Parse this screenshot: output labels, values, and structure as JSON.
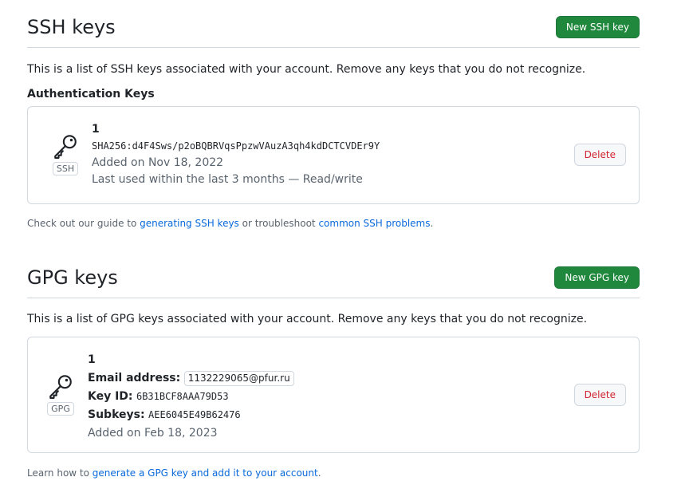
{
  "ssh": {
    "title": "SSH keys",
    "new_button": "New SSH key",
    "description": "This is a list of SSH keys associated with your account. Remove any keys that you do not recognize.",
    "subheading": "Authentication Keys",
    "key": {
      "type_badge": "SSH",
      "title": "1",
      "fingerprint": "SHA256:d4F4Sws/p2oBQBRVqsPpzwVAuzA3qh4kdDCTCVDEr9Y",
      "added": "Added on Nov 18, 2022",
      "last_used": "Last used within the last 3 months — Read/write",
      "delete_label": "Delete"
    },
    "footnote": {
      "prefix": "Check out our guide to ",
      "link1": "generating SSH keys",
      "middle": " or troubleshoot ",
      "link2": "common SSH problems",
      "suffix": "."
    }
  },
  "gpg": {
    "title": "GPG keys",
    "new_button": "New GPG key",
    "description": "This is a list of GPG keys associated with your account. Remove any keys that you do not recognize.",
    "key": {
      "type_badge": "GPG",
      "title": "1",
      "email_label": "Email address:",
      "email_value": "1132229065@pfur.ru",
      "keyid_label": "Key ID:",
      "keyid_value": "6B31BCF8AAA79D53",
      "subkeys_label": "Subkeys:",
      "subkeys_value": "AEE6045E49B62476",
      "added": "Added on Feb 18, 2023",
      "delete_label": "Delete"
    },
    "footnote": {
      "prefix": "Learn how to ",
      "link": "generate a GPG key and add it to your account",
      "suffix": "."
    }
  },
  "colors": {
    "primary_button": "#1f883d",
    "danger_text": "#d1242f",
    "link": "#0969da",
    "border": "#d0d7de"
  },
  "icons": [
    "key-icon"
  ]
}
